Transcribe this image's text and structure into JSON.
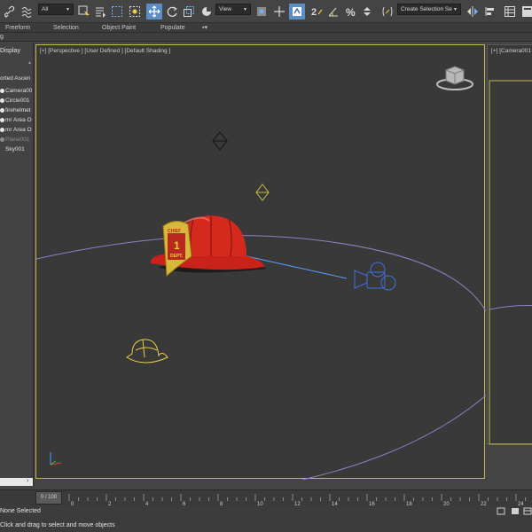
{
  "toolbar": {
    "filter_dropdown": "All",
    "view_dropdown": "View",
    "selection_set_dropdown": "Create Selection Se",
    "angle_snap_label": "2",
    "percent_snap_label": "%",
    "icons": [
      "link-icon",
      "unlink-icon",
      "bind-space-warp-icon",
      "select-object-icon",
      "select-by-name-icon",
      "rect-selection-icon",
      "window-crossing-icon",
      "select-move-icon",
      "select-rotate-icon",
      "select-scale-icon",
      "place-icon",
      "manipulate-icon",
      "keyboard-shortcut-icon",
      "snap-toggle-icon",
      "angle-snap-icon",
      "percent-snap-icon",
      "spinner-snap-icon",
      "edit-named-selection-icon",
      "mirror-icon",
      "align-icon",
      "scene-explorer-icon",
      "layer-explorer-icon"
    ]
  },
  "ribbon": {
    "tabs": [
      "Freeform",
      "Selection",
      "Object Paint",
      "Populate"
    ],
    "strip_label": "g"
  },
  "explorer": {
    "header": "Display",
    "sort_label": "orted Ascen",
    "items": [
      {
        "label": "Camera00",
        "dim": false
      },
      {
        "label": "Circle001",
        "dim": false
      },
      {
        "label": "firehelmet",
        "dim": false
      },
      {
        "label": "mr Area O",
        "dim": false
      },
      {
        "label": "mr Area O",
        "dim": false
      },
      {
        "label": "Plane001",
        "dim": true
      },
      {
        "label": "Sky001",
        "dim": false
      }
    ]
  },
  "viewport_main": {
    "label": "[+] [Perspective ] [User Defined ] [Default Shading ]"
  },
  "viewport_side": {
    "label": "[+] [Camera001"
  },
  "timeline": {
    "frame_counter": "0 / 100",
    "ticks": [
      "0",
      "2",
      "4",
      "6",
      "8",
      "10",
      "12",
      "14",
      "16",
      "18",
      "20",
      "22",
      "24"
    ]
  },
  "status": {
    "selection": "None Selected",
    "prompt": "Click and drag to select and move objects"
  },
  "helmet": {
    "badge_top": "CHIEF",
    "badge_dept": "DEPT.",
    "badge_number": "1"
  },
  "colors": {
    "accent_active": "#5b8ec7",
    "viewport_border_active": "#c8b84a",
    "helmet_red": "#d42a1e",
    "badge_gold": "#d7b83a",
    "light_gizmo": "#1a1a1a",
    "camera_blue": "#3f6fe0"
  }
}
